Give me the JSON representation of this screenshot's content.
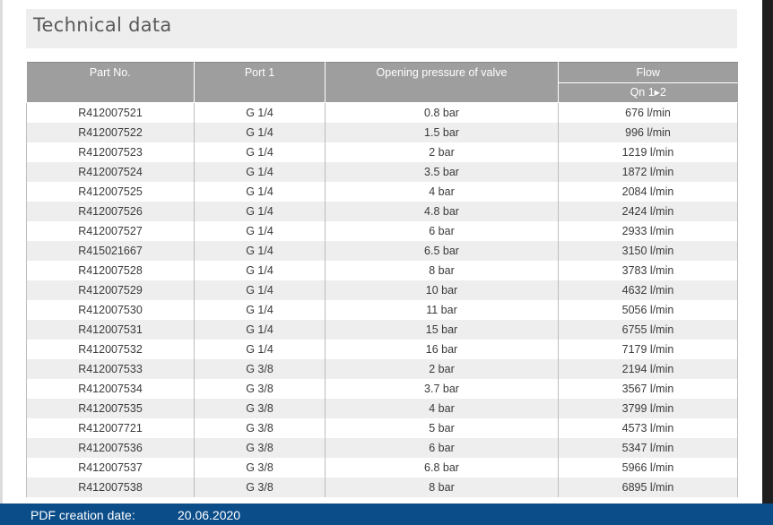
{
  "title": "Technical data",
  "columns": {
    "part_no": "Part No.",
    "port": "Port 1",
    "pressure": "Opening pressure of valve",
    "flow": "Flow",
    "flow_sub": "Qn 1▸2"
  },
  "rows": [
    [
      "R412007521",
      "G 1/4",
      "0.8 bar",
      "676 l/min"
    ],
    [
      "R412007522",
      "G 1/4",
      "1.5 bar",
      "996 l/min"
    ],
    [
      "R412007523",
      "G 1/4",
      "2 bar",
      "1219 l/min"
    ],
    [
      "R412007524",
      "G 1/4",
      "3.5 bar",
      "1872 l/min"
    ],
    [
      "R412007525",
      "G 1/4",
      "4 bar",
      "2084 l/min"
    ],
    [
      "R412007526",
      "G 1/4",
      "4.8 bar",
      "2424 l/min"
    ],
    [
      "R412007527",
      "G 1/4",
      "6 bar",
      "2933 l/min"
    ],
    [
      "R415021667",
      "G 1/4",
      "6.5 bar",
      "3150 l/min"
    ],
    [
      "R412007528",
      "G 1/4",
      "8 bar",
      "3783 l/min"
    ],
    [
      "R412007529",
      "G 1/4",
      "10 bar",
      "4632 l/min"
    ],
    [
      "R412007530",
      "G 1/4",
      "11 bar",
      "5056 l/min"
    ],
    [
      "R412007531",
      "G 1/4",
      "15 bar",
      "6755 l/min"
    ],
    [
      "R412007532",
      "G 1/4",
      "16 bar",
      "7179 l/min"
    ],
    [
      "R412007533",
      "G 3/8",
      "2 bar",
      "2194 l/min"
    ],
    [
      "R412007534",
      "G 3/8",
      "3.7 bar",
      "3567 l/min"
    ],
    [
      "R412007535",
      "G 3/8",
      "4 bar",
      "3799 l/min"
    ],
    [
      "R412007721",
      "G 3/8",
      "5 bar",
      "4573 l/min"
    ],
    [
      "R412007536",
      "G 3/8",
      "6 bar",
      "5347 l/min"
    ],
    [
      "R412007537",
      "G 3/8",
      "6.8 bar",
      "5966 l/min"
    ],
    [
      "R412007538",
      "G 3/8",
      "8 bar",
      "6895 l/min"
    ]
  ],
  "footer": {
    "label": "PDF creation date:",
    "date": "20.06.2020"
  }
}
